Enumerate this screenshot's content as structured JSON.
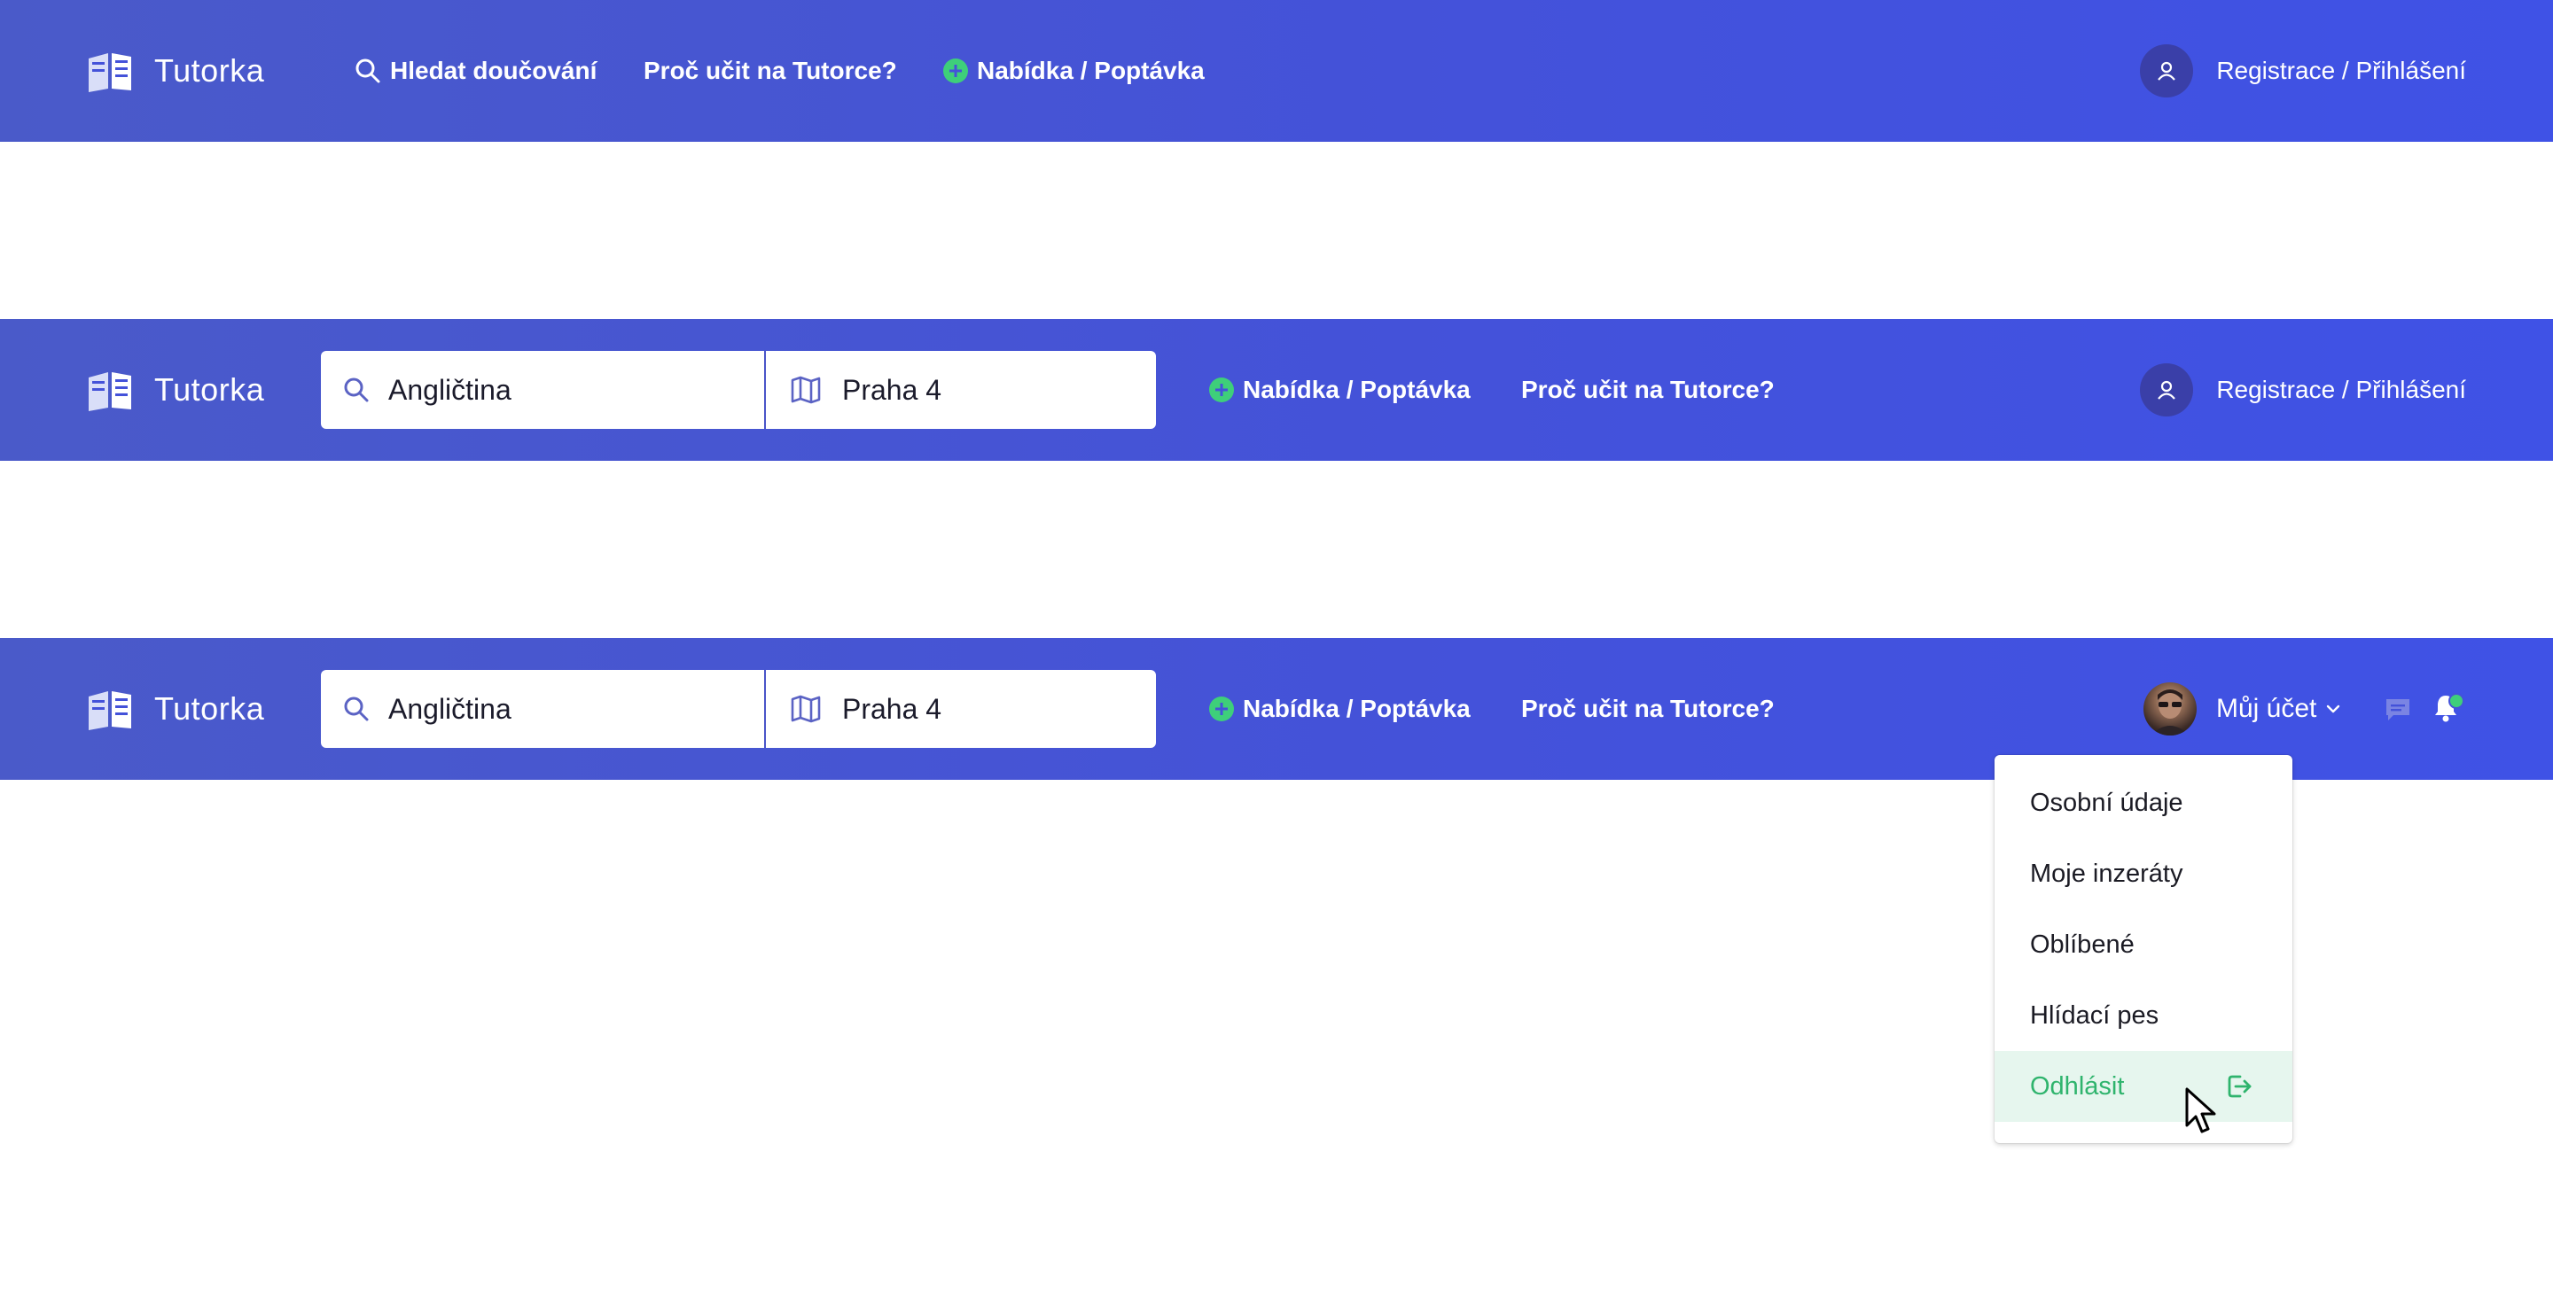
{
  "brand": {
    "name": "Tutorka"
  },
  "colors": {
    "header": "#4452d9",
    "accent_green": "#3ecf7a",
    "logout_green": "#2fb46d"
  },
  "header_guest_home": {
    "nav": {
      "search_label": "Hledat doučování",
      "why_label": "Proč učit na Tutorce?",
      "offer_label": "Nabídka / Poptávka"
    },
    "auth_label": "Registrace / Přihlášení"
  },
  "header_guest_search": {
    "search": {
      "subject_value": "Angličtina",
      "location_value": "Praha 4"
    },
    "nav": {
      "offer_label": "Nabídka / Poptávka",
      "why_label": "Proč učit na Tutorce?"
    },
    "auth_label": "Registrace / Přihlášení"
  },
  "header_logged_in": {
    "search": {
      "subject_value": "Angličtina",
      "location_value": "Praha 4"
    },
    "nav": {
      "offer_label": "Nabídka / Poptávka",
      "why_label": "Proč učit na Tutorce?"
    },
    "account_label": "Můj účet",
    "icons": [
      "chat-icon",
      "bell-icon"
    ],
    "account_menu": {
      "items": [
        {
          "label": "Osobní údaje"
        },
        {
          "label": "Moje inzeráty"
        },
        {
          "label": "Oblíbené"
        },
        {
          "label": "Hlídací pes"
        },
        {
          "label": "Odhlásit",
          "active": true
        }
      ]
    }
  }
}
